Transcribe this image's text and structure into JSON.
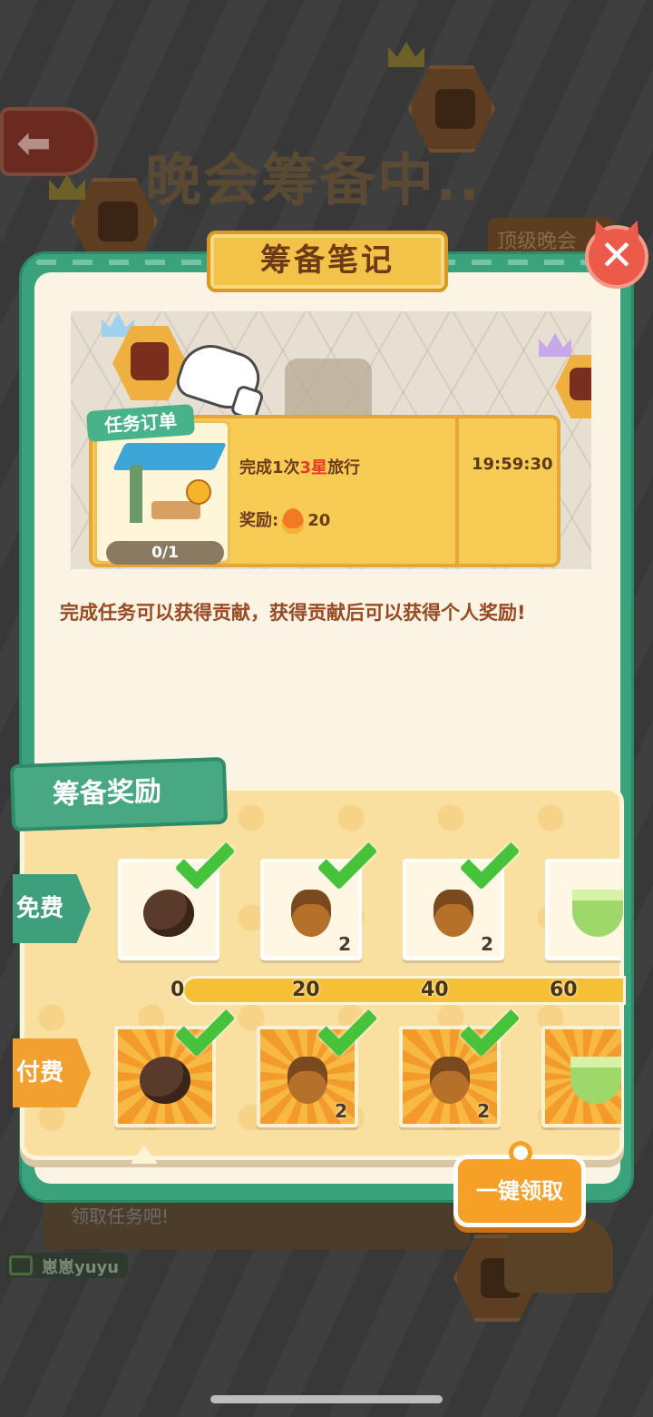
{
  "background": {
    "title": "晚会筹备中..",
    "tag_text": "顶级晚会",
    "footer_text": "领取任务吧!",
    "username": "崽崽yuyu"
  },
  "panel": {
    "title": "筹备笔记",
    "close_icon": "close-icon",
    "accent_color": "#3aa37d"
  },
  "task": {
    "tab_label": "任务订单",
    "progress": "0/1",
    "desc_prefix": "完成1次",
    "desc_star": "3星",
    "desc_suffix": "旅行",
    "reward_label": "奖励:",
    "reward_amount": "20",
    "timer": "19:59:30"
  },
  "explanation": "完成任务可以获得贡献，获得贡献后可以获得个人奖励!",
  "rewards": {
    "header": "筹备奖励",
    "free_label": "免费",
    "paid_label": "付费",
    "milestones": [
      "0",
      "20",
      "40",
      "60"
    ],
    "free_items": [
      {
        "icon": "bomb-icon",
        "qty": "",
        "claimed": true
      },
      {
        "icon": "acorn-icon",
        "qty": "2",
        "claimed": true
      },
      {
        "icon": "acorn-icon",
        "qty": "2",
        "claimed": true
      },
      {
        "icon": "soup-bowl-icon",
        "qty": "",
        "claimed": true
      }
    ],
    "paid_items": [
      {
        "icon": "bomb-icon",
        "qty": "",
        "claimed": true
      },
      {
        "icon": "acorn-icon",
        "qty": "2",
        "claimed": true
      },
      {
        "icon": "acorn-icon",
        "qty": "2",
        "claimed": true
      },
      {
        "icon": "soup-bowl-icon",
        "qty": "",
        "claimed": true
      }
    ],
    "claim_all": "一键领取"
  }
}
